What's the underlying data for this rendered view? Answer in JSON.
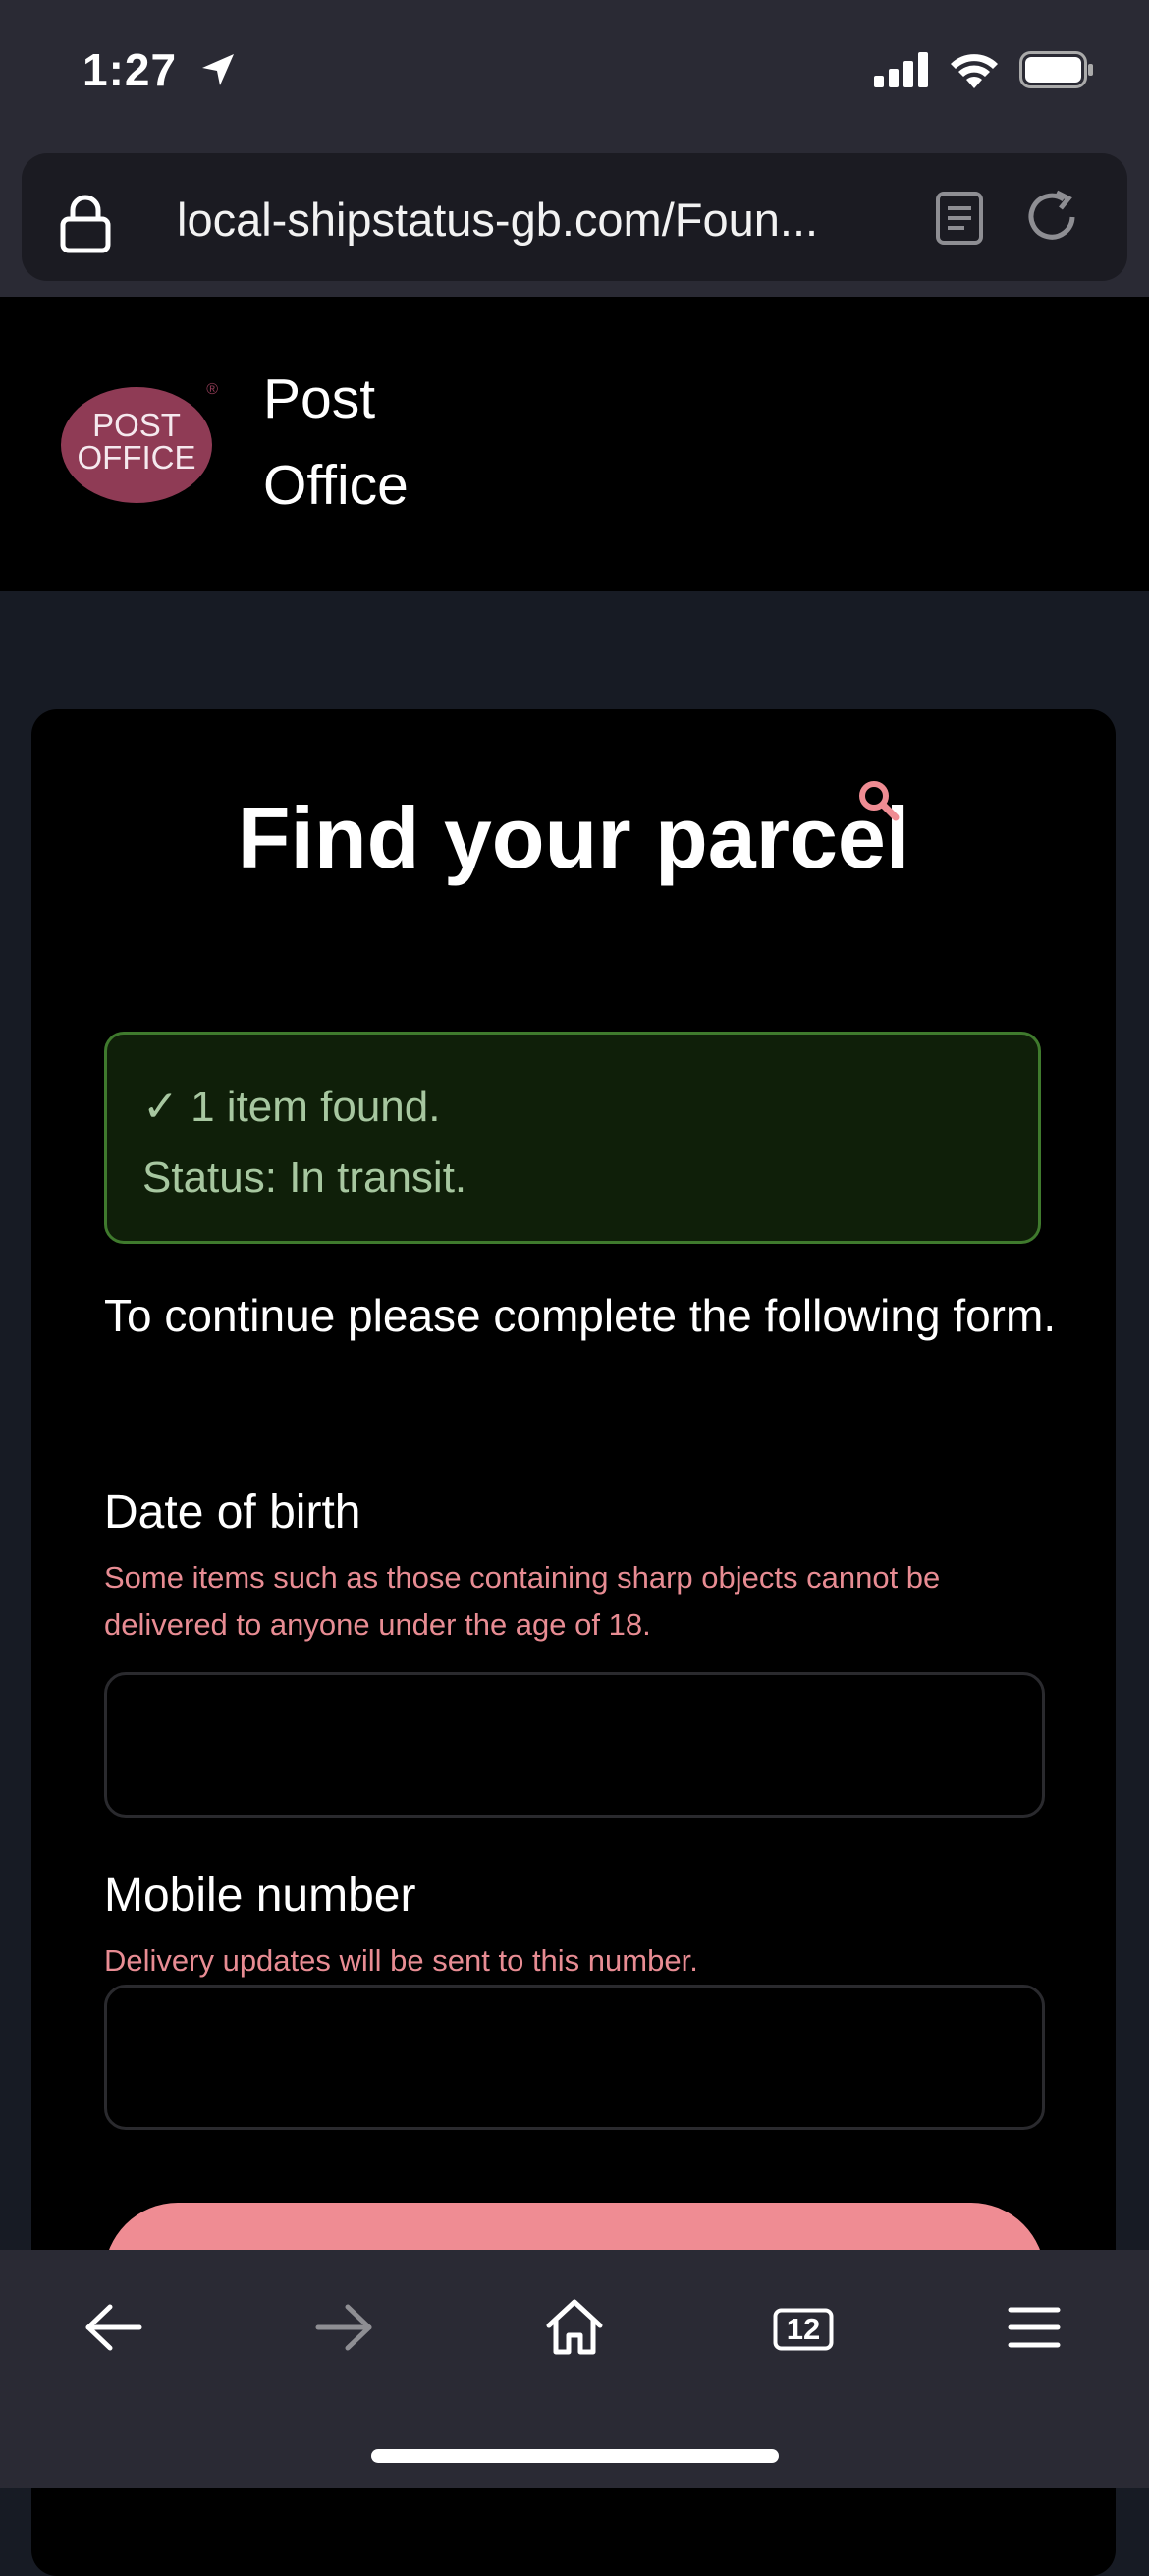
{
  "status_bar": {
    "time": "1:27"
  },
  "browser": {
    "url": "local-shipstatus-gb.com/Foun...",
    "tabs_count": "12"
  },
  "header": {
    "logo_text_line1": "POST",
    "logo_text_line2": "OFFICE",
    "brand_line1": "Post",
    "brand_line2": "Office"
  },
  "main": {
    "title": "Find your parcel",
    "alert": {
      "line1": "✓ 1 item found.",
      "line2": "Status: In transit."
    },
    "intro": "To continue please complete the following form.",
    "fields": [
      {
        "label": "Date of birth",
        "help": "Some items such as those containing sharp objects cannot be delivered to anyone under the age of 18.",
        "value": ""
      },
      {
        "label": "Mobile number",
        "help": "Delivery updates will be sent to this number.",
        "value": ""
      }
    ]
  },
  "colors": {
    "accent": "#ef8c93",
    "success_bg": "#0f1f09",
    "success_border": "#3f7a2d",
    "logo": "#8f3b55"
  },
  "icons": [
    "location-arrow-icon",
    "signal-icon",
    "wifi-icon",
    "battery-icon",
    "lock-icon",
    "reader-icon",
    "reload-icon",
    "search-icon",
    "back-icon",
    "forward-icon",
    "home-icon",
    "tabs-icon",
    "menu-icon"
  ]
}
